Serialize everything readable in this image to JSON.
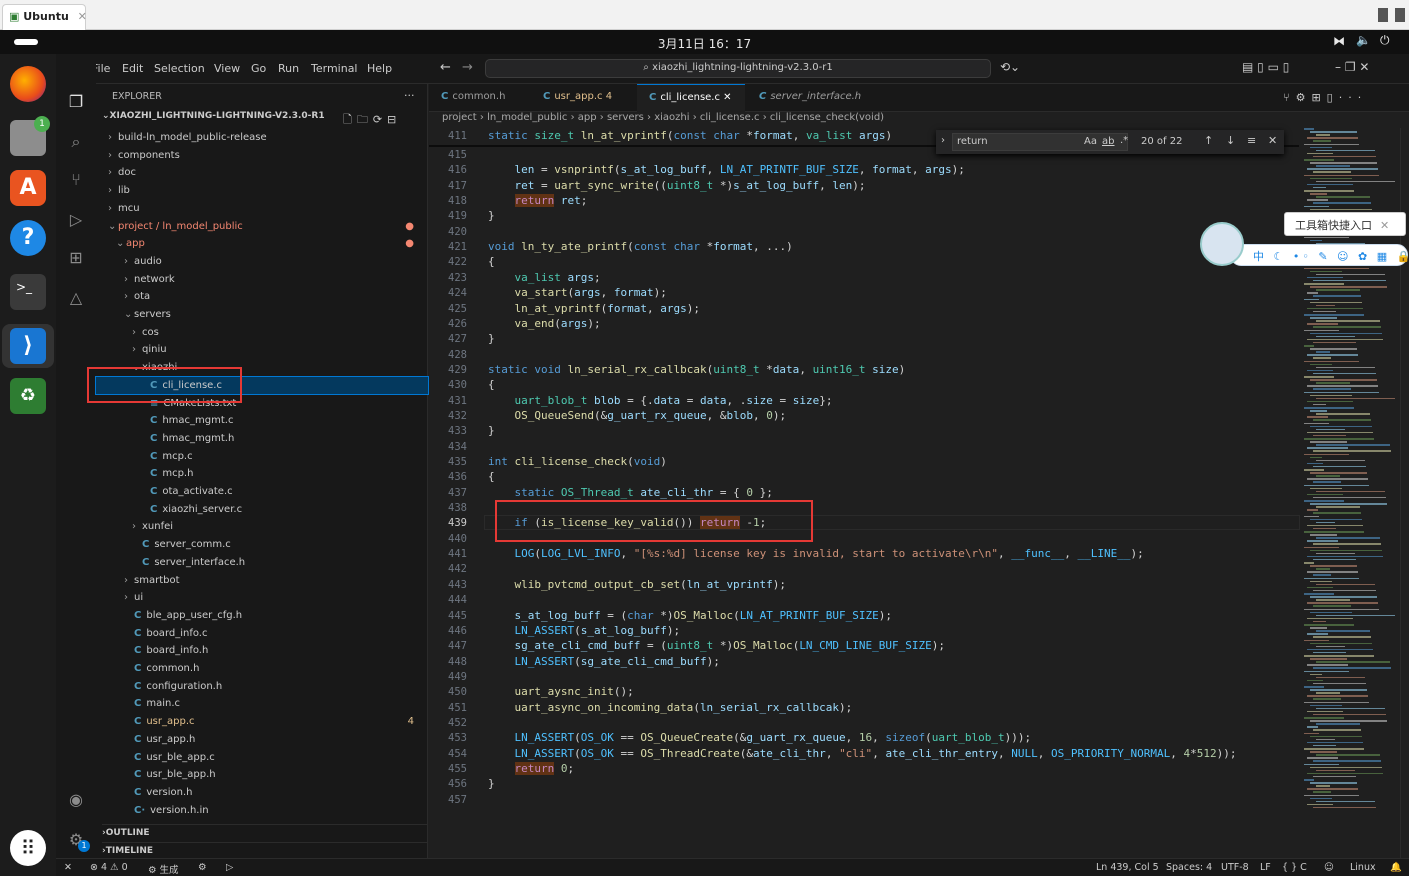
{
  "vm_tab": {
    "label": "Ubuntu"
  },
  "clock": "3月11日 16：17",
  "menu": [
    "File",
    "Edit",
    "Selection",
    "View",
    "Go",
    "Run",
    "Terminal",
    "Help"
  ],
  "search": "xiaozhi_lightning-lightning-v2.3.0-r1",
  "explorer": {
    "title": "EXPLORER",
    "root": "XIAOZHI_LIGHTNING-LIGHTNING-V2.3.0-R1",
    "items": [
      {
        "label": "build-ln_model_public-release",
        "kind": "folder",
        "open": false,
        "indent": 0
      },
      {
        "label": "components",
        "kind": "folder",
        "open": false,
        "indent": 0
      },
      {
        "label": "doc",
        "kind": "folder",
        "open": false,
        "indent": 0
      },
      {
        "label": "lib",
        "kind": "folder",
        "open": false,
        "indent": 0
      },
      {
        "label": "mcu",
        "kind": "folder",
        "open": false,
        "indent": 0
      },
      {
        "label": "project / ln_model_public",
        "kind": "folder",
        "open": true,
        "indent": 0,
        "state": "err"
      },
      {
        "label": "app",
        "kind": "folder",
        "open": true,
        "indent": 1,
        "state": "err"
      },
      {
        "label": "audio",
        "kind": "folder",
        "open": false,
        "indent": 2
      },
      {
        "label": "network",
        "kind": "folder",
        "open": false,
        "indent": 2
      },
      {
        "label": "ota",
        "kind": "folder",
        "open": false,
        "indent": 2
      },
      {
        "label": "servers",
        "kind": "folder",
        "open": true,
        "indent": 2
      },
      {
        "label": "cos",
        "kind": "folder",
        "open": false,
        "indent": 3
      },
      {
        "label": "qiniu",
        "kind": "folder",
        "open": false,
        "indent": 3
      },
      {
        "label": "xiaozhi",
        "kind": "folder",
        "open": true,
        "indent": 3
      },
      {
        "label": "cli_license.c",
        "kind": "c",
        "indent": 4,
        "selected": true
      },
      {
        "label": "CMakeLists.txt",
        "kind": "txt",
        "indent": 4
      },
      {
        "label": "hmac_mgmt.c",
        "kind": "c",
        "indent": 4
      },
      {
        "label": "hmac_mgmt.h",
        "kind": "c",
        "indent": 4
      },
      {
        "label": "mcp.c",
        "kind": "c",
        "indent": 4
      },
      {
        "label": "mcp.h",
        "kind": "c",
        "indent": 4
      },
      {
        "label": "ota_activate.c",
        "kind": "c",
        "indent": 4
      },
      {
        "label": "xiaozhi_server.c",
        "kind": "c",
        "indent": 4
      },
      {
        "label": "xunfei",
        "kind": "folder",
        "open": false,
        "indent": 3
      },
      {
        "label": "server_comm.c",
        "kind": "c",
        "indent": 3
      },
      {
        "label": "server_interface.h",
        "kind": "c",
        "indent": 3
      },
      {
        "label": "smartbot",
        "kind": "folder",
        "open": false,
        "indent": 2
      },
      {
        "label": "ui",
        "kind": "folder",
        "open": false,
        "indent": 2
      },
      {
        "label": "ble_app_user_cfg.h",
        "kind": "c",
        "indent": 2
      },
      {
        "label": "board_info.c",
        "kind": "c",
        "indent": 2
      },
      {
        "label": "board_info.h",
        "kind": "c",
        "indent": 2
      },
      {
        "label": "common.h",
        "kind": "c",
        "indent": 2
      },
      {
        "label": "configuration.h",
        "kind": "c",
        "indent": 2
      },
      {
        "label": "main.c",
        "kind": "c",
        "indent": 2
      },
      {
        "label": "usr_app.c",
        "kind": "c",
        "indent": 2,
        "state": "mod",
        "badge": "4"
      },
      {
        "label": "usr_app.h",
        "kind": "c",
        "indent": 2
      },
      {
        "label": "usr_ble_app.c",
        "kind": "c",
        "indent": 2
      },
      {
        "label": "usr_ble_app.h",
        "kind": "c",
        "indent": 2
      },
      {
        "label": "version.h",
        "kind": "c",
        "indent": 2
      },
      {
        "label": "version.h.in",
        "kind": "cin",
        "indent": 2
      }
    ],
    "outline": "OUTLINE",
    "timeline": "TIMELINE"
  },
  "tabs": [
    {
      "label": "common.h",
      "active": false
    },
    {
      "label": "usr_app.c",
      "badge": "4",
      "active": false,
      "state": "mod"
    },
    {
      "label": "cli_license.c",
      "active": true
    },
    {
      "label": "server_interface.h",
      "active": false,
      "italic": true
    }
  ],
  "breadcrumb": [
    "project",
    "ln_model_public",
    "app",
    "servers",
    "xiaozhi",
    "cli_license.c",
    "cli_license_check(void)"
  ],
  "sticky": {
    "num": "411",
    "text": "static size_t ln_at_vprintf(const char *format, va_list args)"
  },
  "find": {
    "value": "return",
    "count": "20 of 22",
    "aa": "Aa",
    "ab": "ab",
    "re": ".*"
  },
  "code": [
    {
      "n": "415",
      "t": ""
    },
    {
      "n": "416",
      "t": "    len = vsnprintf(s_at_log_buff, LN_AT_PRINTF_BUF_SIZE, format, args);"
    },
    {
      "n": "417",
      "t": "    ret = uart_sync_write((uint8_t *)s_at_log_buff, len);"
    },
    {
      "n": "418",
      "t": "    return ret;"
    },
    {
      "n": "419",
      "t": "}"
    },
    {
      "n": "420",
      "t": ""
    },
    {
      "n": "421",
      "t": "void ln_ty_ate_printf(const char *format, ...)"
    },
    {
      "n": "422",
      "t": "{"
    },
    {
      "n": "423",
      "t": "    va_list args;"
    },
    {
      "n": "424",
      "t": "    va_start(args, format);"
    },
    {
      "n": "425",
      "t": "    ln_at_vprintf(format, args);"
    },
    {
      "n": "426",
      "t": "    va_end(args);"
    },
    {
      "n": "427",
      "t": "}"
    },
    {
      "n": "428",
      "t": ""
    },
    {
      "n": "429",
      "t": "static void ln_serial_rx_callbcak(uint8_t *data, uint16_t size)"
    },
    {
      "n": "430",
      "t": "{"
    },
    {
      "n": "431",
      "t": "    uart_blob_t blob = {.data = data, .size = size};"
    },
    {
      "n": "432",
      "t": "    OS_QueueSend(&g_uart_rx_queue, &blob, 0);"
    },
    {
      "n": "433",
      "t": "}"
    },
    {
      "n": "434",
      "t": ""
    },
    {
      "n": "435",
      "t": "int cli_license_check(void)"
    },
    {
      "n": "436",
      "t": "{"
    },
    {
      "n": "437",
      "t": "    static OS_Thread_t ate_cli_thr = { 0 };"
    },
    {
      "n": "438",
      "t": ""
    },
    {
      "n": "439",
      "t": "    if (is_license_key_valid()) return -1;"
    },
    {
      "n": "440",
      "t": ""
    },
    {
      "n": "441",
      "t": "    LOG(LOG_LVL_INFO, \"[%s:%d] license key is invalid, start to activate\\r\\n\", __func__, __LINE__);"
    },
    {
      "n": "442",
      "t": ""
    },
    {
      "n": "443",
      "t": "    wlib_pvtcmd_output_cb_set(ln_at_vprintf);"
    },
    {
      "n": "444",
      "t": ""
    },
    {
      "n": "445",
      "t": "    s_at_log_buff = (char *)OS_Malloc(LN_AT_PRINTF_BUF_SIZE);"
    },
    {
      "n": "446",
      "t": "    LN_ASSERT(s_at_log_buff);"
    },
    {
      "n": "447",
      "t": "    sg_ate_cli_cmd_buff = (uint8_t *)OS_Malloc(LN_CMD_LINE_BUF_SIZE);"
    },
    {
      "n": "448",
      "t": "    LN_ASSERT(sg_ate_cli_cmd_buff);"
    },
    {
      "n": "449",
      "t": ""
    },
    {
      "n": "450",
      "t": "    uart_aysnc_init();"
    },
    {
      "n": "451",
      "t": "    uart_async_on_incoming_data(ln_serial_rx_callbcak);"
    },
    {
      "n": "452",
      "t": ""
    },
    {
      "n": "453",
      "t": "    LN_ASSERT(OS_OK == OS_QueueCreate(&g_uart_rx_queue, 16, sizeof(uart_blob_t)));"
    },
    {
      "n": "454",
      "t": "    LN_ASSERT(OS_OK == OS_ThreadCreate(&ate_cli_thr, \"cli\", ate_cli_thr_entry, NULL, OS_PRIORITY_NORMAL, 4*512));"
    },
    {
      "n": "455",
      "t": "    return 0;"
    },
    {
      "n": "456",
      "t": "}"
    },
    {
      "n": "457",
      "t": ""
    }
  ],
  "toolbox": {
    "label": "工具箱快捷入口",
    "ime": "中"
  },
  "status": {
    "errors": "4",
    "warnings": "0",
    "build": "生成",
    "position": "Ln 439, Col 5",
    "spaces": "Spaces: 4",
    "encoding": "UTF-8",
    "eol": "LF",
    "lang": "{ } C",
    "os": "Linux"
  },
  "dock": {
    "badge_files": "1",
    "badge_settings": "1"
  }
}
